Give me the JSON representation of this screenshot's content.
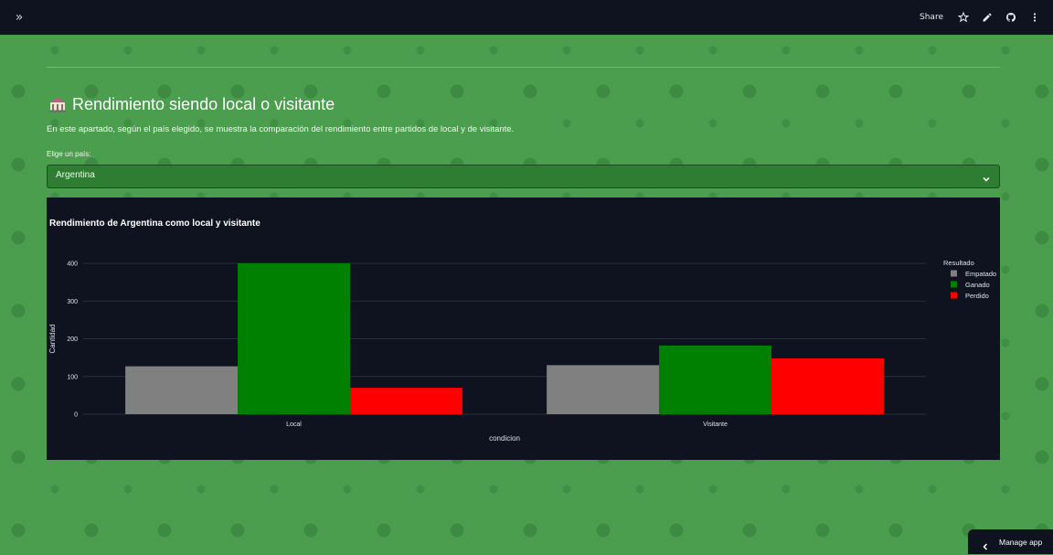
{
  "topbar": {
    "share_label": "Share",
    "icons": [
      "expand-sidebar-icon",
      "star-icon",
      "edit-icon",
      "github-icon",
      "more-vertical-icon"
    ]
  },
  "page": {
    "title": "Rendimiento siendo local o visitante",
    "description": "En este apartado, según el país elegido, se muestra la comparación del rendimiento entre partidos de local y de visitante.",
    "select_label": "Elige un país:",
    "select_value": "Argentina"
  },
  "colors": {
    "background": "#4a9e4e",
    "select_bg": "#2e7d32",
    "dark": "#0f1320",
    "empatado": "#808080",
    "ganado": "#008000",
    "perdido": "#ff0000"
  },
  "chart_data": {
    "type": "bar",
    "title": "Rendimiento de Argentina como local y visitante",
    "xlabel": "condicion",
    "ylabel": "Cantidad",
    "categories": [
      "Local",
      "Visitante"
    ],
    "series": [
      {
        "name": "Empatado",
        "values": [
          127,
          130
        ],
        "color": "#808080"
      },
      {
        "name": "Ganado",
        "values": [
          400,
          182
        ],
        "color": "#008000"
      },
      {
        "name": "Perdido",
        "values": [
          70,
          148
        ],
        "color": "#ff0000"
      }
    ],
    "ylim": [
      0,
      400
    ],
    "yticks": [
      0,
      100,
      200,
      300,
      400
    ],
    "legend_title": "Resultado",
    "legend_position": "top-right",
    "grid": true
  },
  "manage_app": {
    "label": "Manage app"
  }
}
